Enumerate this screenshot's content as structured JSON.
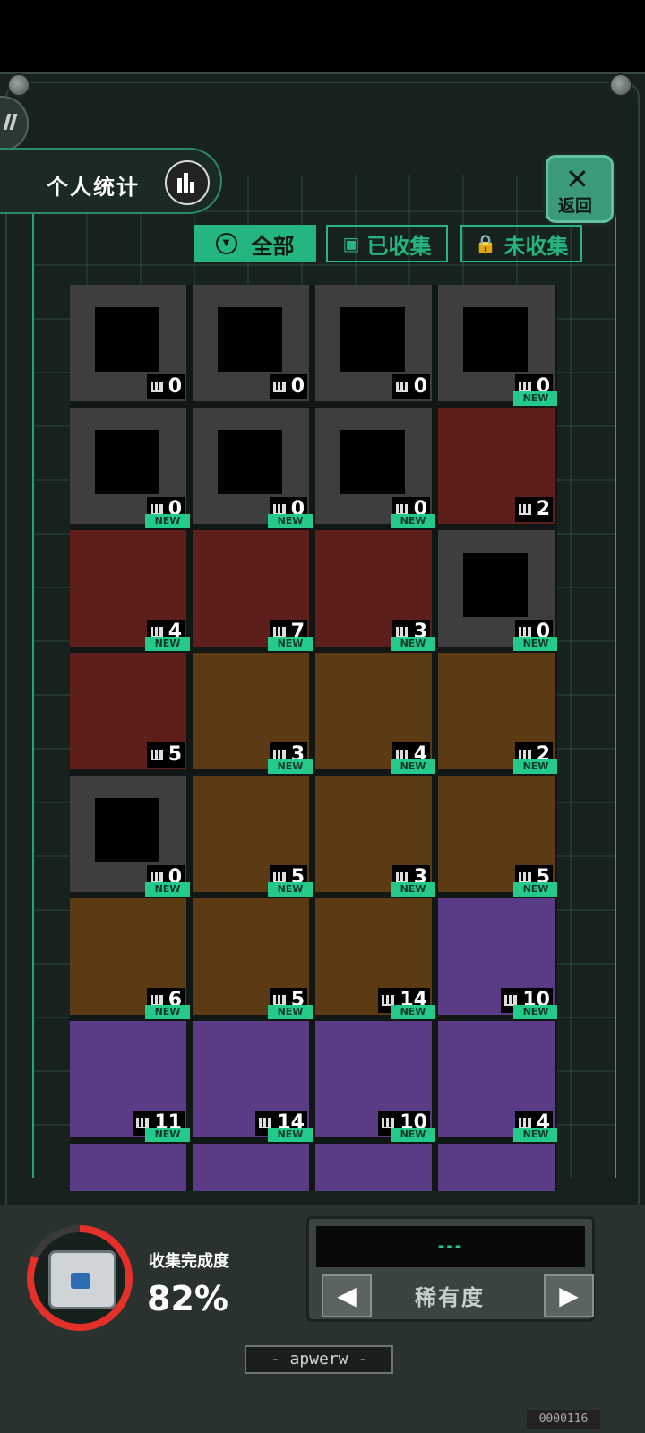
{
  "header": {
    "stats_label": "个人统计",
    "stats_icon": "bar-chart-icon",
    "back_label": "返回",
    "back_icon": "close-x-icon"
  },
  "filters": [
    {
      "label": "全部",
      "active": true,
      "icon": "filter-icon"
    },
    {
      "label": "已收集",
      "active": false,
      "icon": "box-icon"
    },
    {
      "label": "未收集",
      "active": false,
      "icon": "lock-icon"
    }
  ],
  "items": [
    {
      "rarity": "gray",
      "count": "0",
      "new": false,
      "collected": false,
      "icon": "plant-crate-icon"
    },
    {
      "rarity": "gray",
      "count": "0",
      "new": false,
      "collected": false,
      "icon": "slab-icon"
    },
    {
      "rarity": "gray",
      "count": "0",
      "new": false,
      "collected": false,
      "icon": "radio-icon"
    },
    {
      "rarity": "gray",
      "count": "0",
      "new": false,
      "collected": false,
      "icon": "car-icon"
    },
    {
      "rarity": "gray",
      "count": "0",
      "new": false,
      "collected": false,
      "icon": "trophy-cup-icon"
    },
    {
      "rarity": "gray",
      "count": "0",
      "new": false,
      "collected": false,
      "icon": "statue-icon"
    },
    {
      "rarity": "gray",
      "count": "0",
      "new": false,
      "collected": false,
      "icon": "creature-icon"
    },
    {
      "rarity": "red",
      "count": "2",
      "new": true,
      "collected": true,
      "icon": "spaceship-icon"
    },
    {
      "rarity": "red",
      "count": "4",
      "new": true,
      "collected": true,
      "icon": "card-icon"
    },
    {
      "rarity": "red",
      "count": "7",
      "new": true,
      "collected": true,
      "icon": "wood-plank-icon"
    },
    {
      "rarity": "red",
      "count": "3",
      "new": true,
      "collected": true,
      "icon": "silver-coin-icon"
    },
    {
      "rarity": "gray",
      "count": "0",
      "new": false,
      "collected": false,
      "icon": "plant-crate-icon"
    },
    {
      "rarity": "red",
      "count": "5",
      "new": true,
      "collected": true,
      "icon": "gold-coin-icon"
    },
    {
      "rarity": "orange",
      "count": "3",
      "new": true,
      "collected": true,
      "icon": "overalls-icon"
    },
    {
      "rarity": "orange",
      "count": "4",
      "new": true,
      "collected": true,
      "icon": "drone-icon"
    },
    {
      "rarity": "orange",
      "count": "2",
      "new": true,
      "collected": true,
      "icon": "robot-dog-icon"
    },
    {
      "rarity": "gray",
      "count": "0",
      "new": false,
      "collected": false,
      "icon": "cloth-icon"
    },
    {
      "rarity": "orange",
      "count": "5",
      "new": true,
      "collected": true,
      "icon": "guitar-icon"
    },
    {
      "rarity": "orange",
      "count": "3",
      "new": true,
      "collected": true,
      "icon": "phone-icon"
    },
    {
      "rarity": "orange",
      "count": "5",
      "new": true,
      "collected": true,
      "icon": "spinning-top-icon"
    },
    {
      "rarity": "orange",
      "count": "6",
      "new": true,
      "collected": true,
      "icon": "graphics-card-icon"
    },
    {
      "rarity": "orange",
      "count": "5",
      "new": true,
      "collected": true,
      "icon": "fish-helmet-icon"
    },
    {
      "rarity": "orange",
      "count": "14",
      "new": true,
      "collected": true,
      "icon": "cheese-icon"
    },
    {
      "rarity": "purple",
      "count": "10",
      "new": true,
      "collected": true,
      "icon": "terracotta-warrior-icon"
    },
    {
      "rarity": "purple",
      "count": "11",
      "new": true,
      "collected": true,
      "icon": "device-icon"
    },
    {
      "rarity": "purple",
      "count": "14",
      "new": true,
      "collected": true,
      "icon": "penguin-band-icon"
    },
    {
      "rarity": "purple",
      "count": "10",
      "new": true,
      "collected": true,
      "icon": "bmo-robot-icon"
    },
    {
      "rarity": "purple",
      "count": "4",
      "new": true,
      "collected": true,
      "icon": "staff-icon"
    },
    {
      "rarity": "purple",
      "count": "",
      "new": true,
      "collected": true,
      "icon": "card-frame-icon"
    },
    {
      "rarity": "purple",
      "count": "",
      "new": true,
      "collected": true,
      "icon": "misc-icon"
    },
    {
      "rarity": "purple",
      "count": "",
      "new": true,
      "collected": true,
      "icon": "misc-icon"
    },
    {
      "rarity": "purple",
      "count": "",
      "new": true,
      "collected": true,
      "icon": "palm-card-icon"
    }
  ],
  "new_badge": "NEW",
  "completion": {
    "label": "收集完成度",
    "percent_text": "82%",
    "percent": 82
  },
  "rarity_selector": {
    "screen_text": "---",
    "label": "稀有度",
    "sub_text": "• ••••••"
  },
  "plate_text": "- apwerw -",
  "serial_text": "0000116"
}
